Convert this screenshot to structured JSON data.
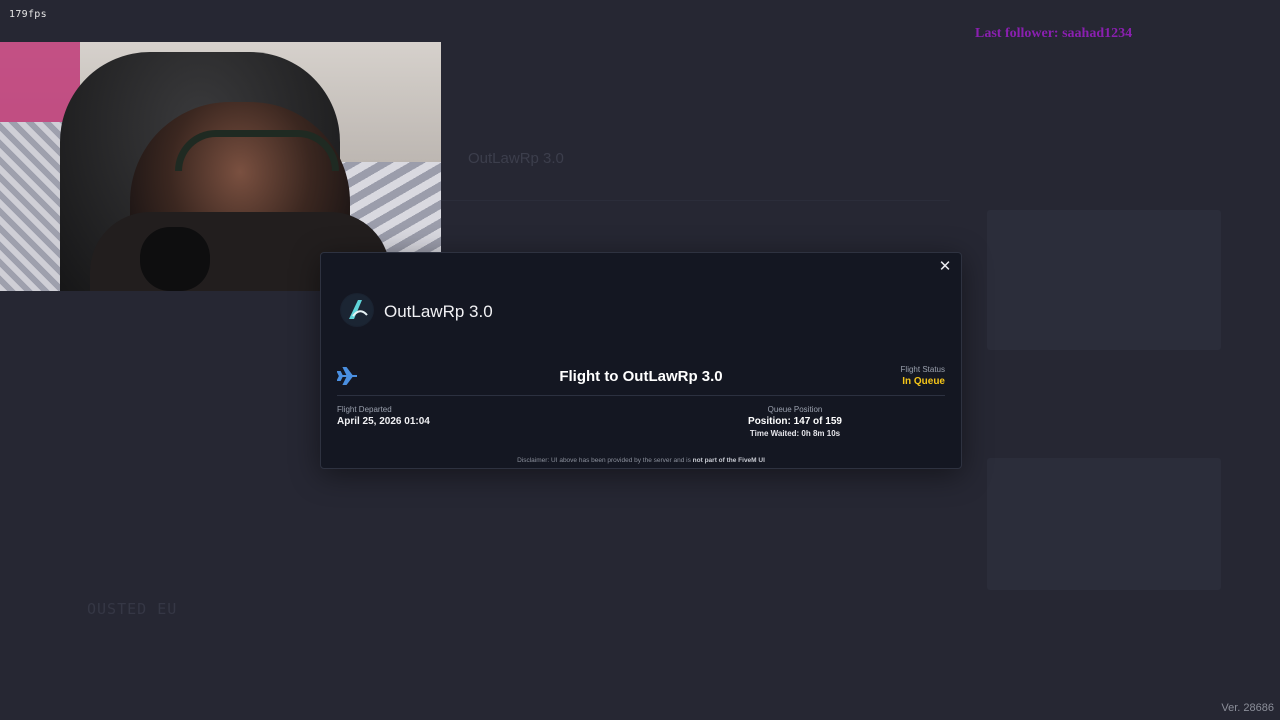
{
  "overlay": {
    "fps": "179fps",
    "last_follower": "Last follower: saahad1234",
    "version": "Ver. 28686",
    "colors": {
      "follower": "#8a1fb0"
    }
  },
  "background": {
    "server_title": "OutLawRp 3.0",
    "server_name_bottom": "OUSTED EU"
  },
  "modal": {
    "close_icon": "close-icon",
    "server_name": "OutLawRp 3.0",
    "flight_title": "Flight to OutLawRp 3.0",
    "flight_status_label": "Flight Status",
    "flight_status_value": "In Queue",
    "departed_label": "Flight Departed",
    "departed_value": "April 25, 2026 01:04",
    "queue_label": "Queue Position",
    "queue_position": "Position: 147 of 159",
    "time_waited": "Time Waited: 0h 8m 10s",
    "disclaimer_prefix": "Disclaimer: UI above has been provided by the server and is ",
    "disclaimer_bold": "not part of the FiveM UI",
    "colors": {
      "status": "#f5c518",
      "plane": "#4a8fe0"
    }
  }
}
